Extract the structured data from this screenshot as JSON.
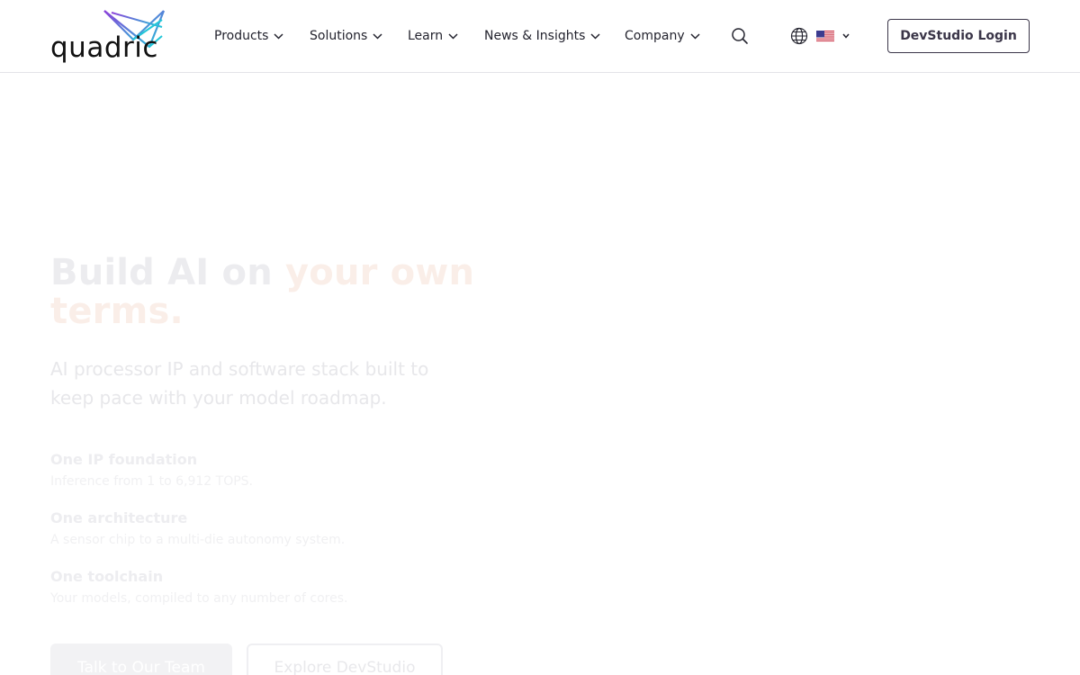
{
  "brand": {
    "name": "quadric"
  },
  "nav": {
    "items": [
      {
        "label": "Products"
      },
      {
        "label": "Solutions"
      },
      {
        "label": "Learn"
      },
      {
        "label": "News & Insights"
      },
      {
        "label": "Company"
      }
    ],
    "login_label": "DevStudio Login",
    "icons": {
      "search": "search-icon",
      "language": "globe-icon",
      "flag": "us-flag-icon"
    }
  },
  "hero": {
    "title_lead": "Build AI on ",
    "title_accent": "your own terms.",
    "subtitle": "AI processor IP and software stack built to keep pace with your model roadmap.",
    "features": [
      {
        "title": "One IP foundation",
        "desc": "Inference from 1 to 6,912 TOPS."
      },
      {
        "title": "One architecture",
        "desc": "A sensor chip to a multi-die autonomy system."
      },
      {
        "title": "One toolchain",
        "desc": "Your models, compiled to any number of cores."
      }
    ],
    "cta_primary": "Talk to Our Team",
    "cta_secondary": "Explore DevStudio"
  },
  "colors": {
    "logo_purple": "#8b3fd9",
    "logo_cyan": "#22c6d8",
    "border_dark": "#3a3548"
  }
}
